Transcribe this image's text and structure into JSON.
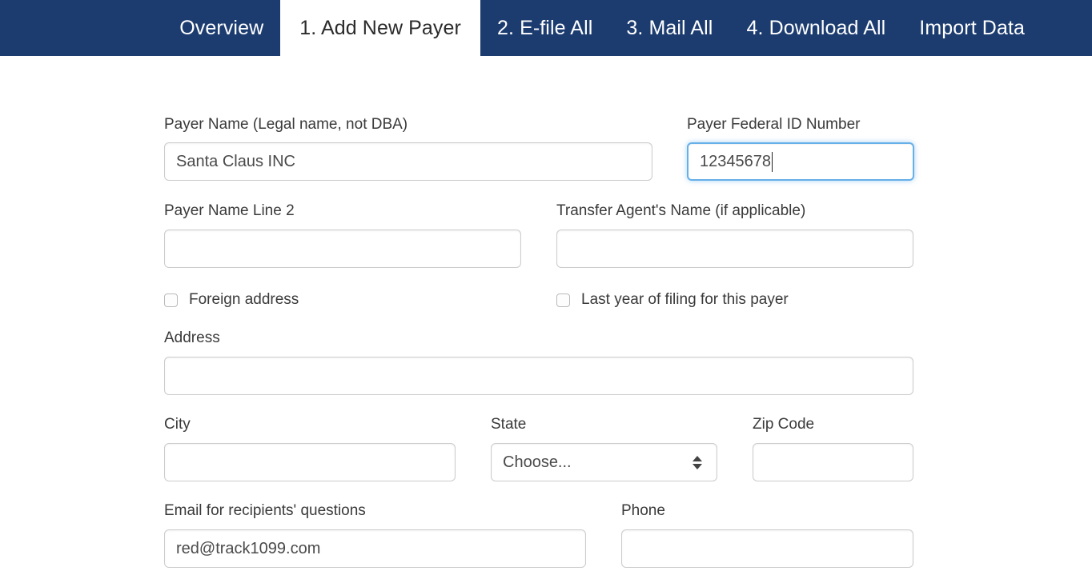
{
  "nav": {
    "background_color": "#1c3c70",
    "active_tab_background": "#ffffff",
    "tabs": [
      {
        "label": "Overview",
        "active": false
      },
      {
        "label": "1. Add New Payer",
        "active": true
      },
      {
        "label": "2. E-file All",
        "active": false
      },
      {
        "label": "3. Mail All",
        "active": false
      },
      {
        "label": "4. Download All",
        "active": false
      },
      {
        "label": "Import Data",
        "active": false
      }
    ]
  },
  "form": {
    "payer_name": {
      "label": "Payer Name (Legal name, not DBA)",
      "value": "Santa Claus INC",
      "placeholder": ""
    },
    "payer_federal_id": {
      "label": "Payer Federal ID Number",
      "value": "12345678",
      "placeholder": "",
      "focused": true,
      "focus_border_color": "#66afe9"
    },
    "payer_name_line2": {
      "label": "Payer Name Line 2",
      "value": "",
      "placeholder": ""
    },
    "transfer_agent_name": {
      "label": "Transfer Agent's Name (if applicable)",
      "value": "",
      "placeholder": ""
    },
    "foreign_address": {
      "label": "Foreign address",
      "checked": false
    },
    "last_year_filing": {
      "label": "Last year of filing for this payer",
      "checked": false
    },
    "address": {
      "label": "Address",
      "value": "",
      "placeholder": ""
    },
    "city": {
      "label": "City",
      "value": "",
      "placeholder": ""
    },
    "state": {
      "label": "State",
      "selected": "Choose...",
      "options": [
        "Choose..."
      ]
    },
    "zip_code": {
      "label": "Zip Code",
      "value": "",
      "placeholder": ""
    },
    "email": {
      "label": "Email for recipients' questions",
      "value": "red@track1099.com",
      "placeholder": ""
    },
    "phone": {
      "label": "Phone",
      "value": "",
      "placeholder": ""
    }
  }
}
